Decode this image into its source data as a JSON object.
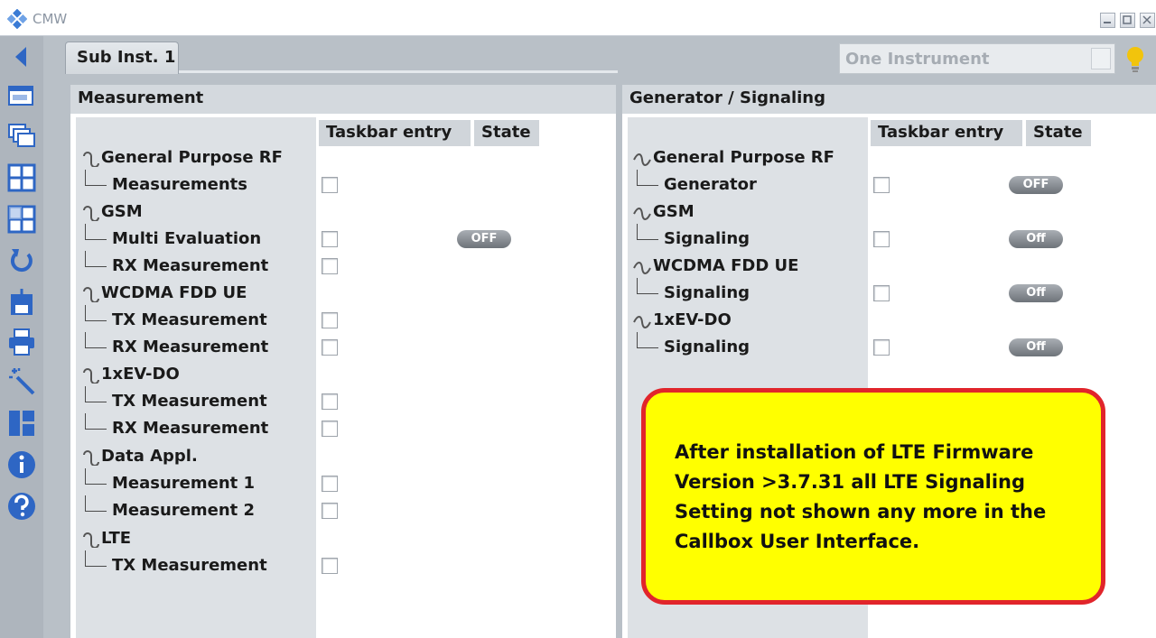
{
  "app": {
    "title": "CMW"
  },
  "header": {
    "tab_label": "Sub Inst. 1",
    "instrument_select_value": "One Instrument"
  },
  "measurement": {
    "panel_title": "Measurement",
    "col_taskbar": "Taskbar entry",
    "col_state": "State",
    "groups": [
      {
        "label": "General Purpose RF",
        "items": [
          {
            "label": "Measurements",
            "state": ""
          }
        ]
      },
      {
        "label": "GSM",
        "items": [
          {
            "label": "Multi Evaluation",
            "state": "OFF"
          },
          {
            "label": "RX Measurement",
            "state": ""
          }
        ]
      },
      {
        "label": "WCDMA FDD UE",
        "items": [
          {
            "label": "TX Measurement",
            "state": ""
          },
          {
            "label": "RX Measurement",
            "state": ""
          }
        ]
      },
      {
        "label": "1xEV-DO",
        "items": [
          {
            "label": "TX Measurement",
            "state": ""
          },
          {
            "label": "RX Measurement",
            "state": ""
          }
        ]
      },
      {
        "label": "Data Appl.",
        "items": [
          {
            "label": "Measurement 1",
            "state": ""
          },
          {
            "label": "Measurement 2",
            "state": ""
          }
        ]
      },
      {
        "label": "LTE",
        "items": [
          {
            "label": "TX Measurement",
            "state": ""
          }
        ]
      }
    ]
  },
  "generator": {
    "panel_title": "Generator / Signaling",
    "col_taskbar": "Taskbar entry",
    "col_state": "State",
    "groups": [
      {
        "label": "General Purpose RF",
        "items": [
          {
            "label": "Generator",
            "state": "OFF"
          }
        ]
      },
      {
        "label": "GSM",
        "items": [
          {
            "label": "Signaling",
            "state": "Off"
          }
        ]
      },
      {
        "label": "WCDMA FDD UE",
        "items": [
          {
            "label": "Signaling",
            "state": "Off"
          }
        ]
      },
      {
        "label": "1xEV-DO",
        "items": [
          {
            "label": "Signaling",
            "state": "Off"
          }
        ]
      }
    ]
  },
  "callout": {
    "lines": [
      "After installation of LTE Firmware",
      "Version >3.7.31 all LTE Signaling",
      "Setting not shown any more in the",
      "Callbox User Interface."
    ]
  },
  "toolbar_icons": [
    "back-arrow-icon",
    "cmw-screen-icon",
    "windows-stack-icon",
    "layout-grid-icon",
    "layout-grid-alt-icon",
    "refresh-icon",
    "save-disk-icon",
    "print-icon",
    "wizard-wand-icon",
    "dashboard-icon",
    "info-icon",
    "help-icon"
  ],
  "colors": {
    "toolbar_icon": "#2e66c4",
    "callout_fill": "#ffff00",
    "callout_border": "#e1252b"
  }
}
